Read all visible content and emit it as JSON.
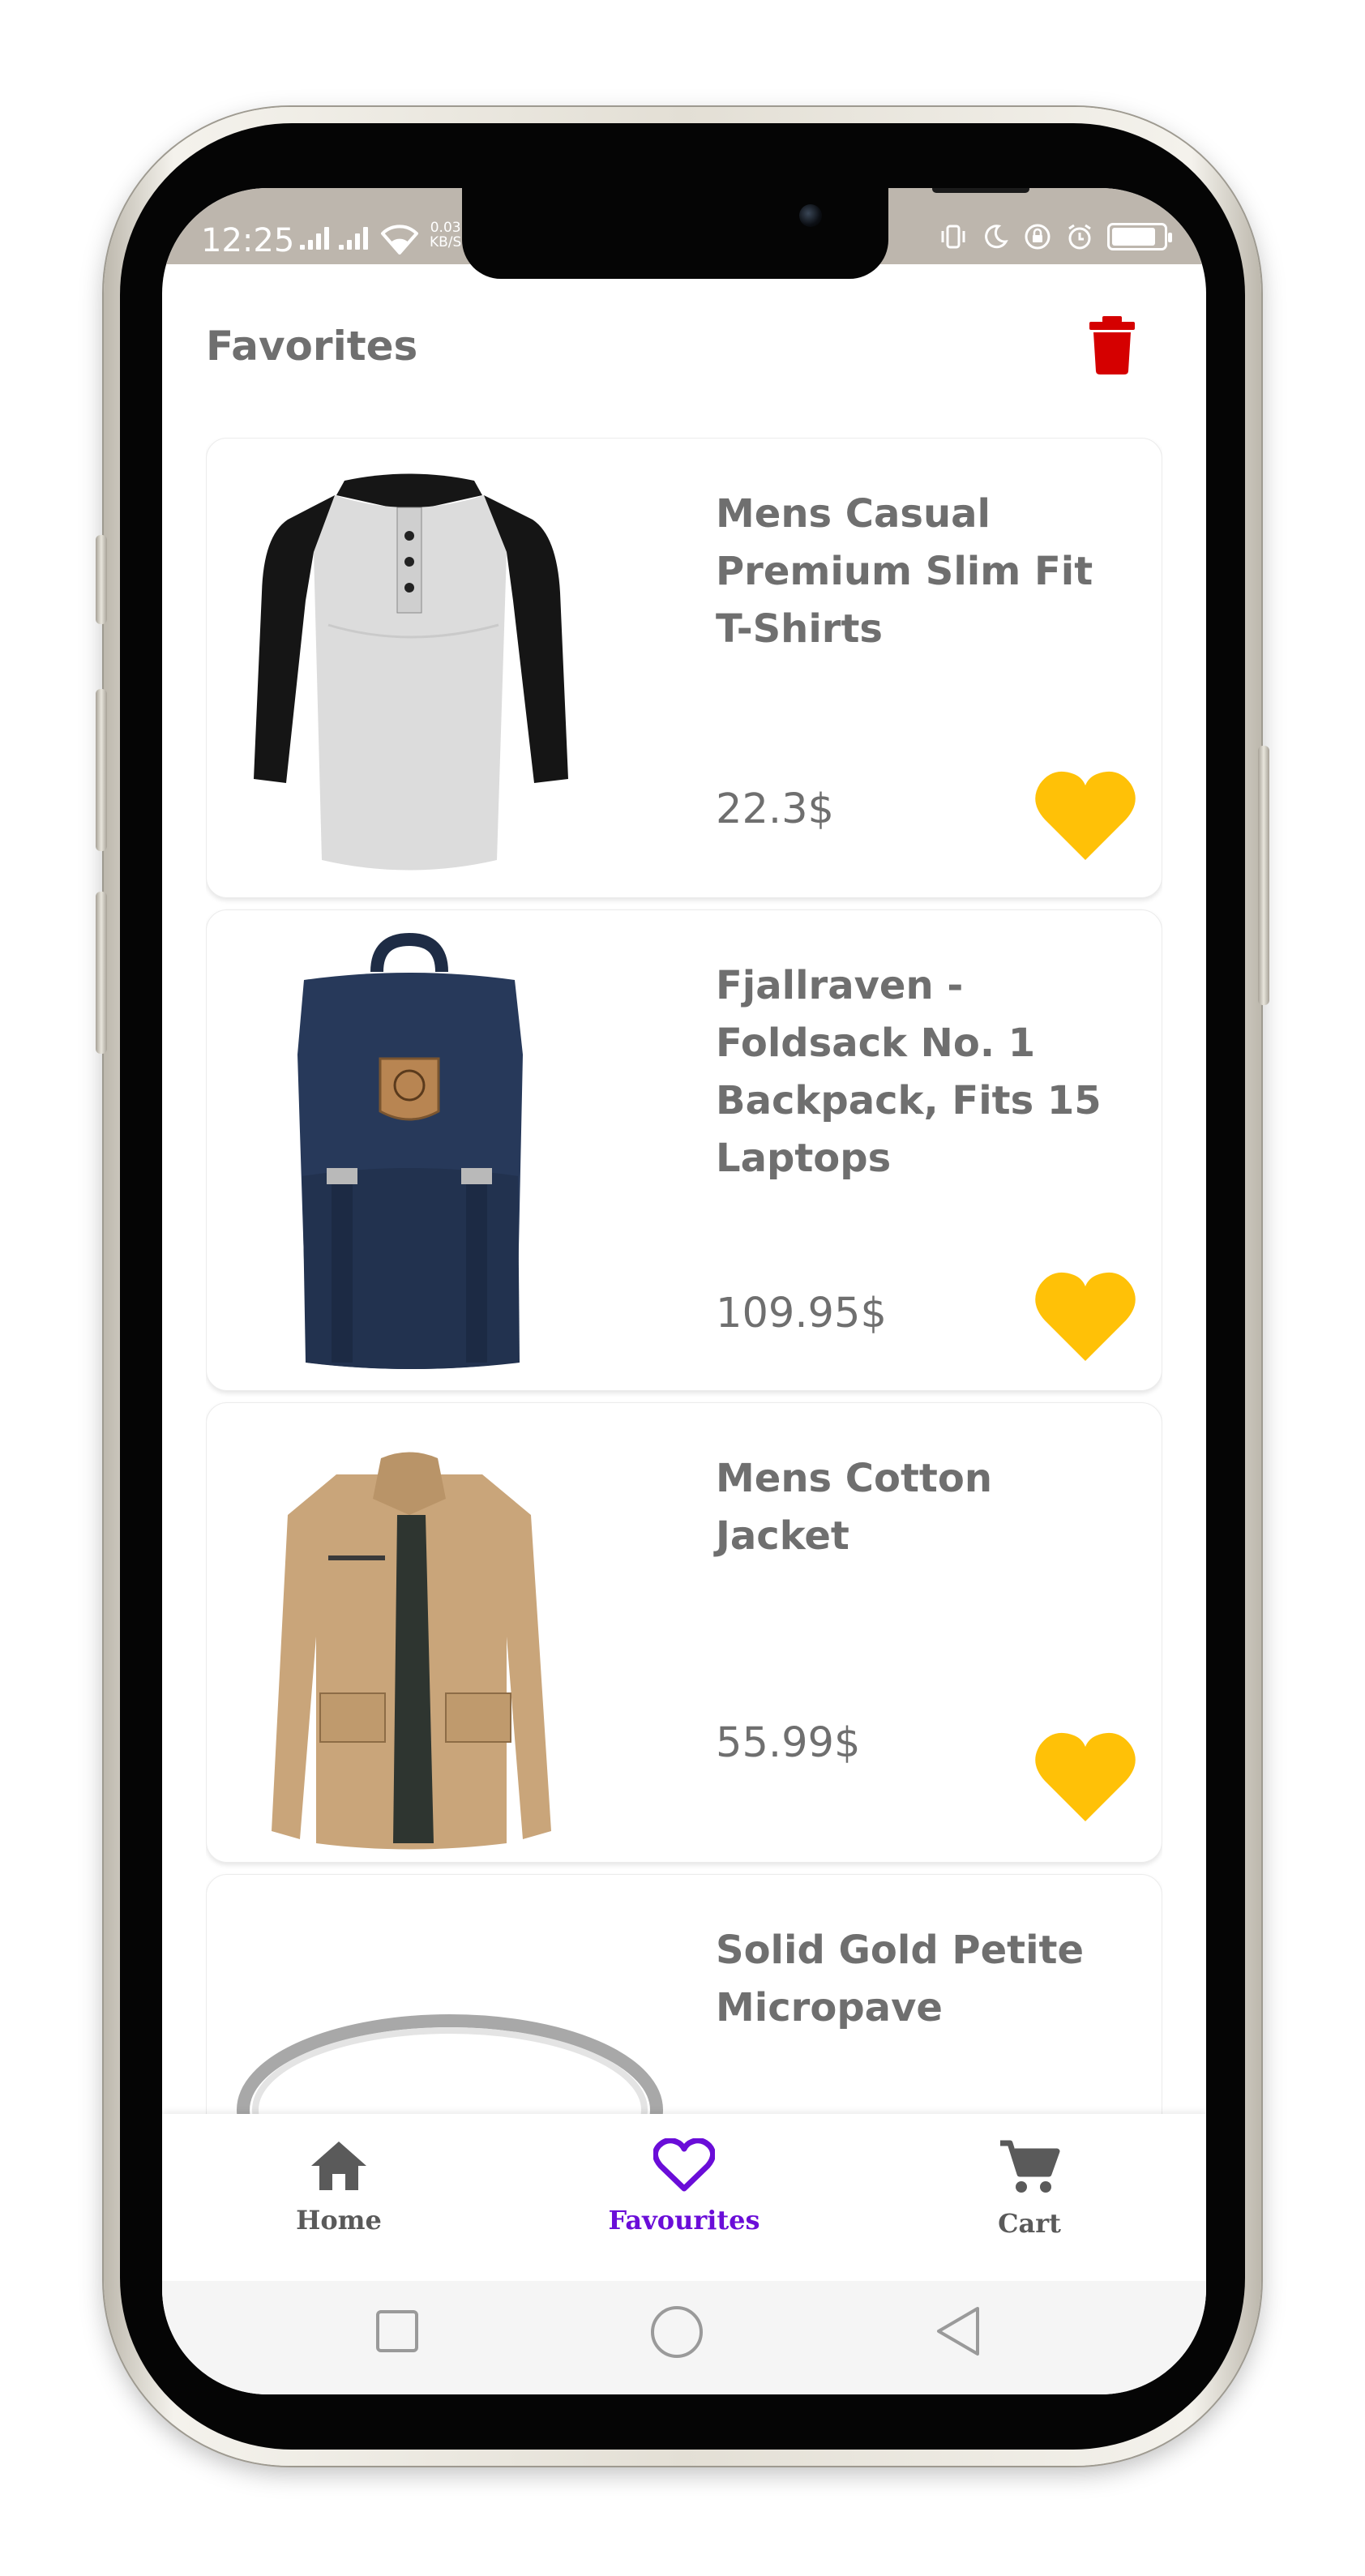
{
  "status_bar": {
    "time": "12:25",
    "net_speed_value": "0.03",
    "net_speed_unit": "KB/S"
  },
  "header": {
    "title": "Favorites"
  },
  "colors": {
    "accent": "#6a0dd8",
    "favorite": "#ffc107",
    "delete": "#d50000",
    "text": "#6f6f6f",
    "status_bar": "#bdb6ad"
  },
  "favorites": [
    {
      "name": "Mens Casual Premium Slim Fit T-Shirts",
      "price": "22.3$",
      "image": "henley-shirt-black-grey"
    },
    {
      "name": "Fjallraven - Foldsack No. 1 Backpack, Fits 15 Laptops",
      "price": "109.95$",
      "image": "navy-backpack"
    },
    {
      "name": "Mens Cotton Jacket",
      "price": "55.99$",
      "image": "khaki-jacket"
    },
    {
      "name": "Solid Gold Petite Micropave",
      "price": "",
      "image": "silver-ring"
    }
  ],
  "bottom_nav": {
    "items": [
      {
        "label": "Home",
        "icon": "home-icon"
      },
      {
        "label": "Favourites",
        "icon": "heart-outline-icon",
        "active": true
      },
      {
        "label": "Cart",
        "icon": "cart-icon"
      }
    ]
  },
  "system_nav": [
    "square-icon",
    "circle-icon",
    "triangle-back-icon"
  ]
}
